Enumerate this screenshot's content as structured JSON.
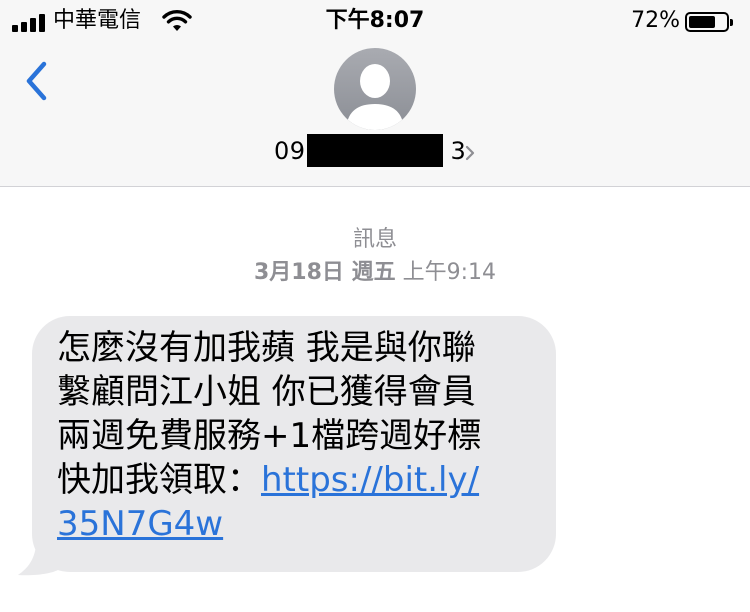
{
  "status_bar": {
    "carrier": "中華電信",
    "time": "下午8:07",
    "battery": "72%",
    "battery_level": 0.72
  },
  "header": {
    "contact_visible": "09",
    "contact_end": "3"
  },
  "conversation": {
    "service_label": "訊息",
    "timestamp_date": "3月18日 週五",
    "timestamp_time": "上午9:14",
    "message": {
      "line1": "怎麼沒有加我蘋 我是與你聯",
      "line2": "繫顧問江小姐 你已獲得會員",
      "line3": "兩週免費服務+1檔跨週好標",
      "line4_text": "快加我領取：",
      "link_part1": "https://bit.ly/",
      "link_part2": "35N7G4w"
    }
  },
  "colors": {
    "accent": "#2a73d9",
    "bubble": "#e9e9eb",
    "header_bg": "#f7f7f7",
    "muted_text": "#8e8e93"
  },
  "icons": {
    "back": "chevron-left-icon",
    "avatar": "person-silhouette-icon",
    "details": "chevron-right-icon",
    "wifi": "wifi-icon",
    "battery": "battery-icon",
    "signal": "signal-bars-icon"
  }
}
